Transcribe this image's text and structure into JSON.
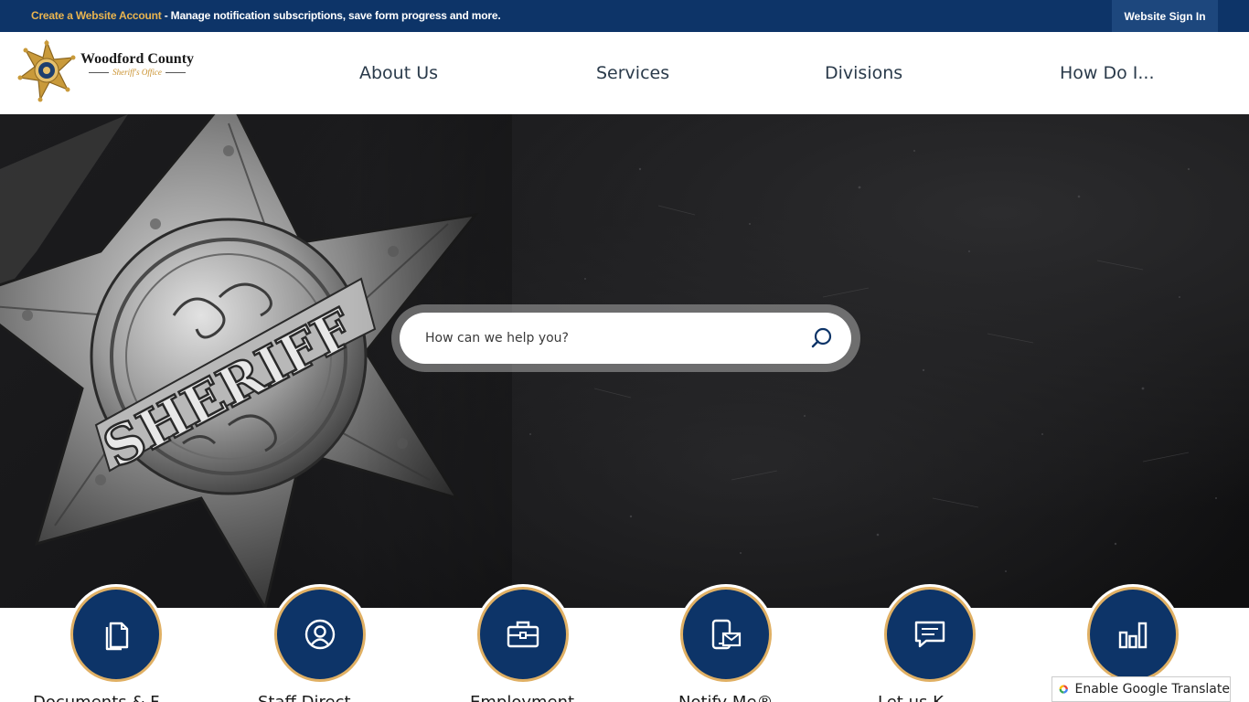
{
  "topbar": {
    "link_text": "Create a Website Account",
    "message": " - Manage notification subscriptions, save form progress and more.",
    "signin_label": "Website Sign In"
  },
  "logo": {
    "title": "Woodford County",
    "subtitle": "Sheriff's Office"
  },
  "nav": {
    "items": [
      {
        "label": "About Us"
      },
      {
        "label": "Services"
      },
      {
        "label": "Divisions"
      },
      {
        "label": "How Do I..."
      }
    ]
  },
  "hero": {
    "badge_text": "SHERIFF"
  },
  "search": {
    "placeholder": "How can we help you?"
  },
  "quick_links": [
    {
      "label": "Documents & F",
      "icon": "document-icon"
    },
    {
      "label": "Staff Direct",
      "icon": "person-icon"
    },
    {
      "label": "Employment",
      "icon": "briefcase-icon"
    },
    {
      "label": "Notify Me®",
      "icon": "notify-icon"
    },
    {
      "label": "Let us K",
      "icon": "chat-icon"
    },
    {
      "label": "",
      "icon": "chart-icon"
    }
  ],
  "translate": {
    "label": "Enable Google Translate"
  },
  "colors": {
    "navy": "#0d3468",
    "gold": "#e0b064",
    "link_gold": "#e9b44f"
  }
}
